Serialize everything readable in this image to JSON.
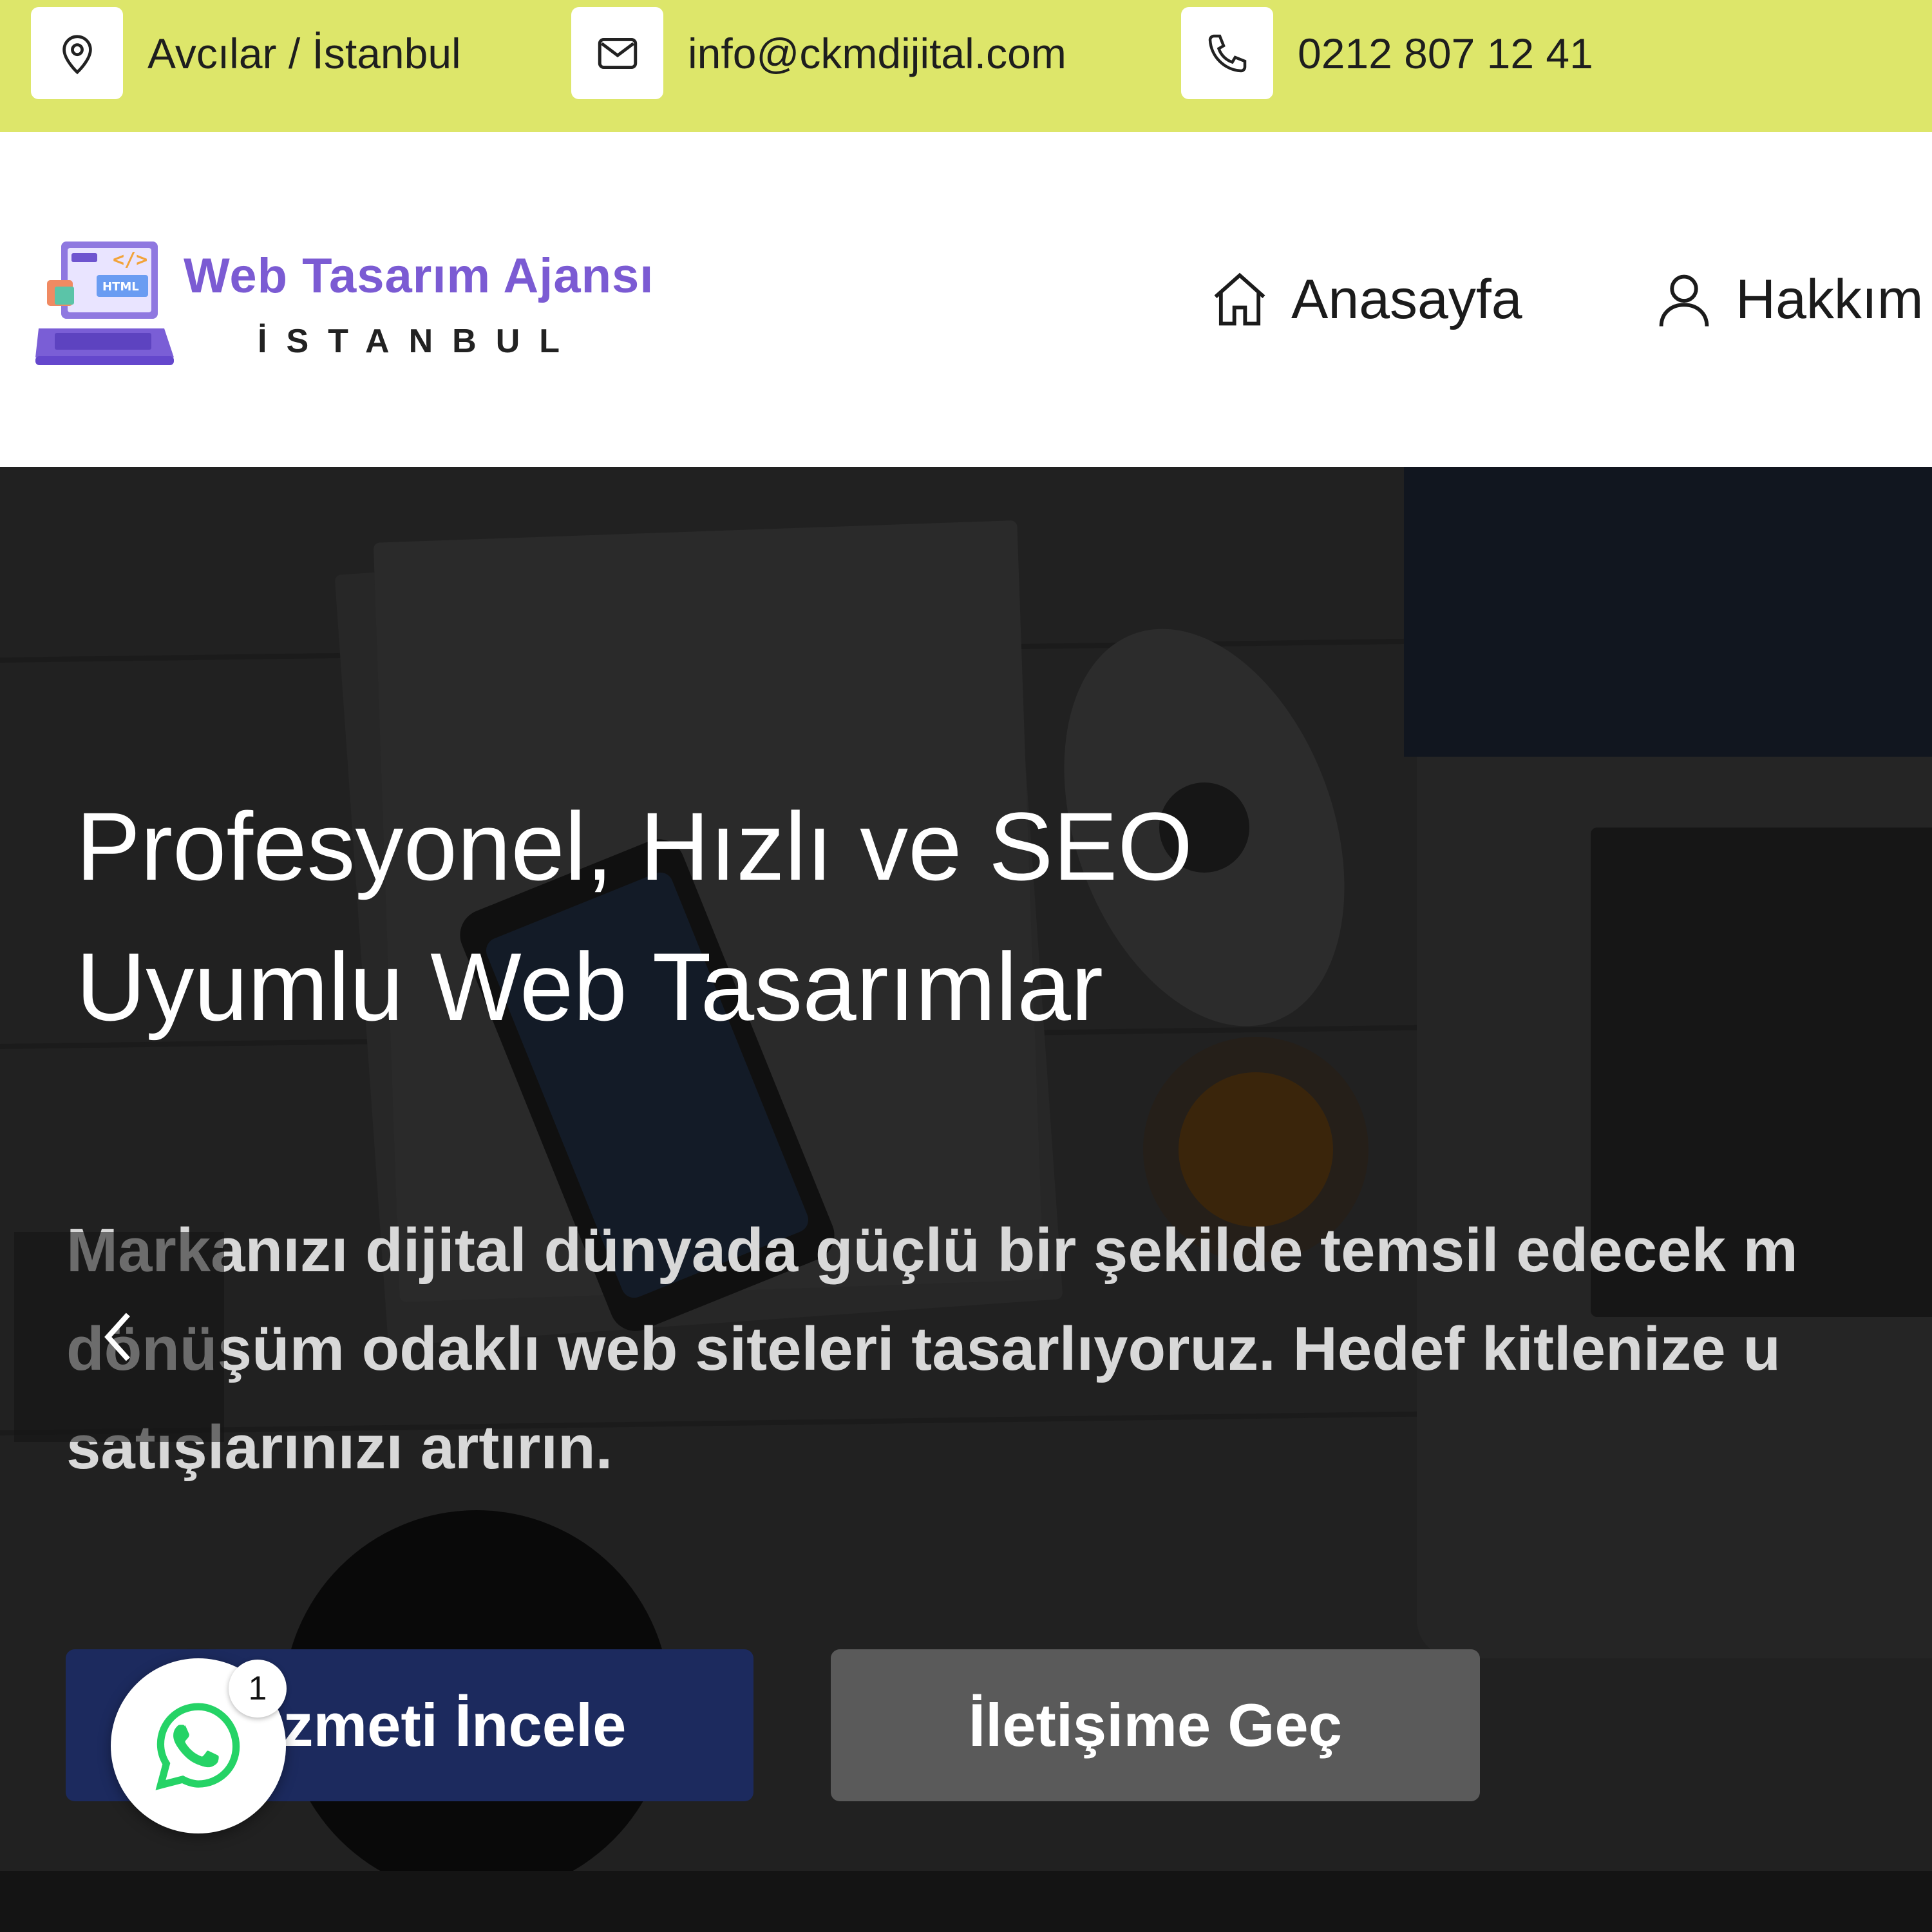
{
  "topbar": {
    "location": {
      "icon": "location-pin-icon",
      "text": "Avcılar / İstanbul"
    },
    "email": {
      "icon": "envelope-icon",
      "text": "info@ckmdijital.com"
    },
    "phone": {
      "icon": "phone-icon",
      "text": "0212 807 12 41"
    },
    "background_color": "#dde66a"
  },
  "header": {
    "logo": {
      "icon": "laptop-html-logo",
      "title": "Web Tasarım Ajansı",
      "subtitle": "İSTANBUL",
      "brand_color": "#7b5bd3"
    },
    "nav": [
      {
        "icon": "home-icon",
        "label": "Anasayfa"
      },
      {
        "icon": "user-icon",
        "label": "Hakkım"
      }
    ]
  },
  "hero": {
    "title_line1": "Profesyonel, Hızlı ve SEO",
    "title_line2": "Uyumlu Web Tasarımlar",
    "desc_line1": "Markanızı dijital dünyada güçlü bir şekilde temsil edecek m",
    "desc_line2": "dönüşüm odaklı web siteleri tasarlıyoruz. Hedef kitlenize u",
    "desc_line3": "satışlarınızı artırın.",
    "primary_button": "zmeti İncele",
    "secondary_button": "İletişime Geç",
    "primary_button_color": "#1c2a5e",
    "prev_icon": "chevron-left-icon"
  },
  "whatsapp": {
    "icon": "whatsapp-icon",
    "badge_count": "1",
    "color": "#25d366"
  }
}
